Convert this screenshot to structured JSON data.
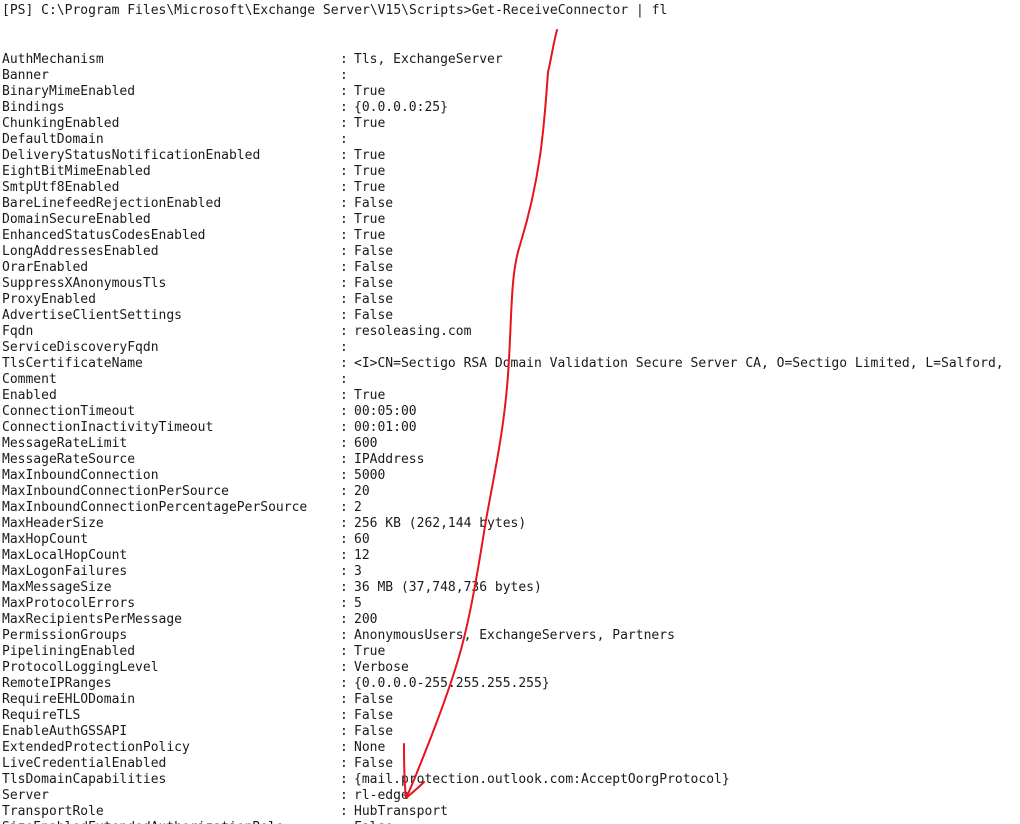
{
  "console": {
    "prompt": "[PS] C:\\Program Files\\Microsoft\\Exchange Server\\V15\\Scripts>",
    "command": "Get-ReceiveConnector | fl",
    "separator": ":",
    "properties": [
      {
        "name": "AuthMechanism",
        "value": "Tls, ExchangeServer"
      },
      {
        "name": "Banner",
        "value": ""
      },
      {
        "name": "BinaryMimeEnabled",
        "value": "True"
      },
      {
        "name": "Bindings",
        "value": "{0.0.0.0:25}"
      },
      {
        "name": "ChunkingEnabled",
        "value": "True"
      },
      {
        "name": "DefaultDomain",
        "value": ""
      },
      {
        "name": "DeliveryStatusNotificationEnabled",
        "value": "True"
      },
      {
        "name": "EightBitMimeEnabled",
        "value": "True"
      },
      {
        "name": "SmtpUtf8Enabled",
        "value": "True"
      },
      {
        "name": "BareLinefeedRejectionEnabled",
        "value": "False"
      },
      {
        "name": "DomainSecureEnabled",
        "value": "True"
      },
      {
        "name": "EnhancedStatusCodesEnabled",
        "value": "True"
      },
      {
        "name": "LongAddressesEnabled",
        "value": "False"
      },
      {
        "name": "OrarEnabled",
        "value": "False"
      },
      {
        "name": "SuppressXAnonymousTls",
        "value": "False"
      },
      {
        "name": "ProxyEnabled",
        "value": "False"
      },
      {
        "name": "AdvertiseClientSettings",
        "value": "False"
      },
      {
        "name": "Fqdn",
        "value": "resoleasing.com"
      },
      {
        "name": "ServiceDiscoveryFqdn",
        "value": ""
      },
      {
        "name": "TlsCertificateName",
        "value": "<I>CN=Sectigo RSA Domain Validation Secure Server CA, O=Sectigo Limited, L=Salford,"
      },
      {
        "name": "Comment",
        "value": ""
      },
      {
        "name": "Enabled",
        "value": "True"
      },
      {
        "name": "ConnectionTimeout",
        "value": "00:05:00"
      },
      {
        "name": "ConnectionInactivityTimeout",
        "value": "00:01:00"
      },
      {
        "name": "MessageRateLimit",
        "value": "600"
      },
      {
        "name": "MessageRateSource",
        "value": "IPAddress"
      },
      {
        "name": "MaxInboundConnection",
        "value": "5000"
      },
      {
        "name": "MaxInboundConnectionPerSource",
        "value": "20"
      },
      {
        "name": "MaxInboundConnectionPercentagePerSource",
        "value": "2"
      },
      {
        "name": "MaxHeaderSize",
        "value": "256 KB (262,144 bytes)"
      },
      {
        "name": "MaxHopCount",
        "value": "60"
      },
      {
        "name": "MaxLocalHopCount",
        "value": "12"
      },
      {
        "name": "MaxLogonFailures",
        "value": "3"
      },
      {
        "name": "MaxMessageSize",
        "value": "36 MB (37,748,736 bytes)"
      },
      {
        "name": "MaxProtocolErrors",
        "value": "5"
      },
      {
        "name": "MaxRecipientsPerMessage",
        "value": "200"
      },
      {
        "name": "PermissionGroups",
        "value": "AnonymousUsers, ExchangeServers, Partners"
      },
      {
        "name": "PipeliningEnabled",
        "value": "True"
      },
      {
        "name": "ProtocolLoggingLevel",
        "value": "Verbose"
      },
      {
        "name": "RemoteIPRanges",
        "value": "{0.0.0.0-255.255.255.255}"
      },
      {
        "name": "RequireEHLODomain",
        "value": "False"
      },
      {
        "name": "RequireTLS",
        "value": "False"
      },
      {
        "name": "EnableAuthGSSAPI",
        "value": "False"
      },
      {
        "name": "ExtendedProtectionPolicy",
        "value": "None"
      },
      {
        "name": "LiveCredentialEnabled",
        "value": "False"
      },
      {
        "name": "TlsDomainCapabilities",
        "value": "{mail.protection.outlook.com:AcceptOorgProtocol}"
      },
      {
        "name": "Server",
        "value": "rl-edge"
      },
      {
        "name": "TransportRole",
        "value": "HubTransport"
      },
      {
        "name": "SizeEnabledExtendedAuthorizationRole",
        "value": "False"
      }
    ]
  },
  "annotation": {
    "color": "#e8141b",
    "description_icon": "red-hand-drawn-arrow-icon"
  }
}
